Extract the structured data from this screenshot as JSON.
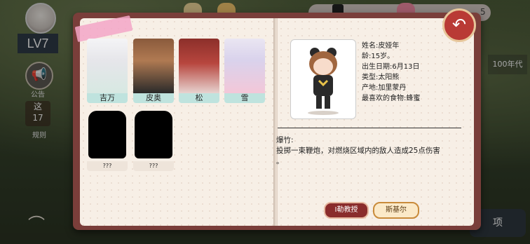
{
  "level_label": "LV7",
  "sidebar": {
    "notice_label": "公告",
    "count_label": "这",
    "count_value": "17",
    "count_sub": "规则",
    "top_right_partial": "5"
  },
  "right_panel": {
    "era_label": "100年代",
    "bottom_button": "项"
  },
  "characters": [
    {
      "name": "吉万",
      "locked": false
    },
    {
      "name": "皮奥",
      "locked": false
    },
    {
      "name": "松",
      "locked": false
    },
    {
      "name": "雪",
      "locked": false
    },
    {
      "name": "???",
      "locked": true
    },
    {
      "name": "???",
      "locked": true
    }
  ],
  "selected": {
    "name_line": "姓名:皮娅年",
    "age_line": "龄:15岁。",
    "birthday_line": "出生日期:6月13日",
    "type_line": "类型:太阳熊",
    "origin_line": "产地:加里蒙丹",
    "food_line": "最喜欢的食物:蜂蜜"
  },
  "skill": {
    "title": "爆竹:",
    "description": "投掷一束鞭炮，对燃烧区域内的敌人造成25点伤害",
    "description_tail": "。"
  },
  "buttons": {
    "teacher": "I勒教授",
    "skirt": "斯基尔"
  },
  "colors": {
    "book_cover": "#7a3e3a",
    "name_tab": "#bfe3de",
    "back_button": "#b93a35",
    "accent_pink": "#f3a6c7"
  }
}
